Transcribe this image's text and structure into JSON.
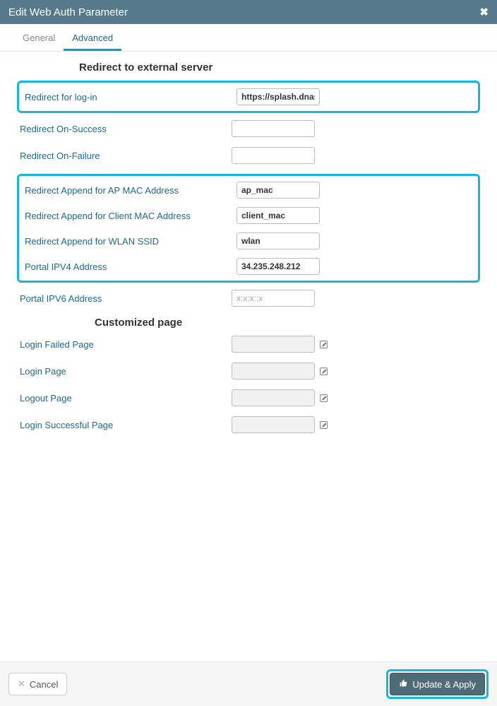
{
  "modal": {
    "title": "Edit Web Auth Parameter"
  },
  "tabs": {
    "general": "General",
    "advanced": "Advanced"
  },
  "sections": {
    "redirect": "Redirect to external server",
    "customized": "Customized page"
  },
  "fields": {
    "redirect_login": {
      "label": "Redirect for log-in",
      "value": "https://splash.dnasp"
    },
    "redirect_success": {
      "label": "Redirect On-Success",
      "value": ""
    },
    "redirect_failure": {
      "label": "Redirect On-Failure",
      "value": ""
    },
    "append_ap_mac": {
      "label": "Redirect Append for AP MAC Address",
      "value": "ap_mac"
    },
    "append_client_mac": {
      "label": "Redirect Append for Client MAC Address",
      "value": "client_mac"
    },
    "append_wlan_ssid": {
      "label": "Redirect Append for WLAN SSID",
      "value": "wlan"
    },
    "portal_ipv4": {
      "label": "Portal IPV4 Address",
      "value": "34.235.248.212"
    },
    "portal_ipv6": {
      "label": "Portal IPV6 Address",
      "value": "",
      "placeholder": "x:x:x::x"
    },
    "login_failed_page": {
      "label": "Login Failed Page",
      "value": ""
    },
    "login_page": {
      "label": "Login Page",
      "value": ""
    },
    "logout_page": {
      "label": "Logout Page",
      "value": ""
    },
    "login_success_page": {
      "label": "Login Successful Page",
      "value": ""
    }
  },
  "buttons": {
    "cancel": "Cancel",
    "apply": "Update & Apply"
  }
}
